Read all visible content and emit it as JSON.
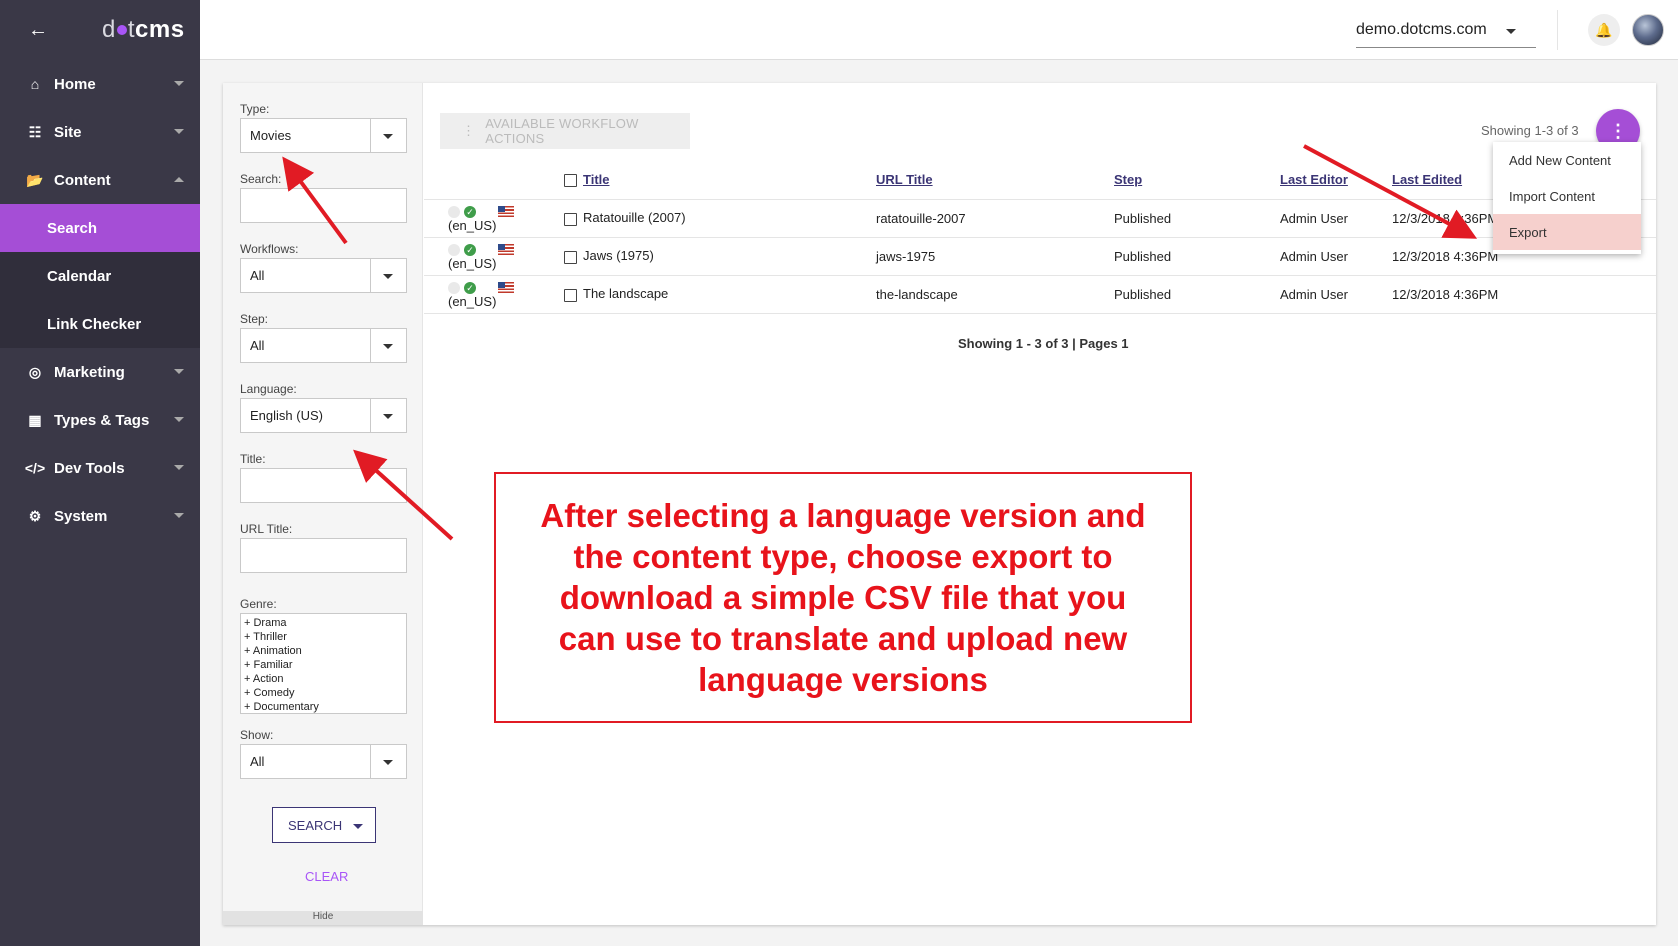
{
  "sidebar": {
    "logo_left": "d",
    "logo_mid": "t",
    "logo_right": "cms",
    "nav": [
      {
        "label": "Home"
      },
      {
        "label": "Site"
      },
      {
        "label": "Content"
      },
      {
        "label": "Marketing"
      },
      {
        "label": "Types & Tags"
      },
      {
        "label": "Dev Tools"
      },
      {
        "label": "System"
      }
    ],
    "content_sub": [
      {
        "label": "Search"
      },
      {
        "label": "Calendar"
      },
      {
        "label": "Link Checker"
      }
    ]
  },
  "header": {
    "site": "demo.dotcms.com"
  },
  "filters": {
    "type_label": "Type:",
    "type_value": "Movies",
    "search_label": "Search:",
    "workflows_label": "Workflows:",
    "workflows_value": "All",
    "step_label": "Step:",
    "step_value": "All",
    "language_label": "Language:",
    "language_value": "English (US)",
    "title_label": "Title:",
    "url_title_label": "URL Title:",
    "genre_label": "Genre:",
    "genres": [
      "+ Drama",
      "+ Thriller",
      "+ Animation",
      "+ Familiar",
      "+ Action",
      "+ Comedy",
      "+ Documentary"
    ],
    "show_label": "Show:",
    "show_value": "All",
    "search_button": "SEARCH",
    "clear_button": "CLEAR",
    "hide_label": "Hide"
  },
  "content": {
    "workflow_button": "AVAILABLE WORKFLOW ACTIONS",
    "showing_top": "Showing 1-3 of 3",
    "columns": [
      "Title",
      "URL Title",
      "Step",
      "Last Editor",
      "Last Edited"
    ],
    "rows": [
      {
        "lang": "(en_US)",
        "title": "Ratatouille (2007)",
        "url_title": "ratatouille-2007",
        "step": "Published",
        "editor": "Admin User",
        "edited": "12/3/2018 4:36PM"
      },
      {
        "lang": "(en_US)",
        "title": "Jaws (1975)",
        "url_title": "jaws-1975",
        "step": "Published",
        "editor": "Admin User",
        "edited": "12/3/2018 4:36PM"
      },
      {
        "lang": "(en_US)",
        "title": "The landscape",
        "url_title": "the-landscape",
        "step": "Published",
        "editor": "Admin User",
        "edited": "12/3/2018 4:36PM"
      }
    ],
    "showing_bottom": "Showing 1 - 3 of 3 | Pages 1"
  },
  "menu": {
    "items": [
      {
        "label": "Add New Content"
      },
      {
        "label": "Import Content"
      },
      {
        "label": "Export"
      }
    ]
  },
  "annotation": {
    "text": "After selecting a language version and the content type, choose export to download a simple CSV file that you can use to translate and upload new language versions",
    "color": "#e8131b"
  },
  "colors": {
    "accent": "#a54ed6",
    "sidebar": "#3a3847",
    "link": "#3b3575"
  }
}
